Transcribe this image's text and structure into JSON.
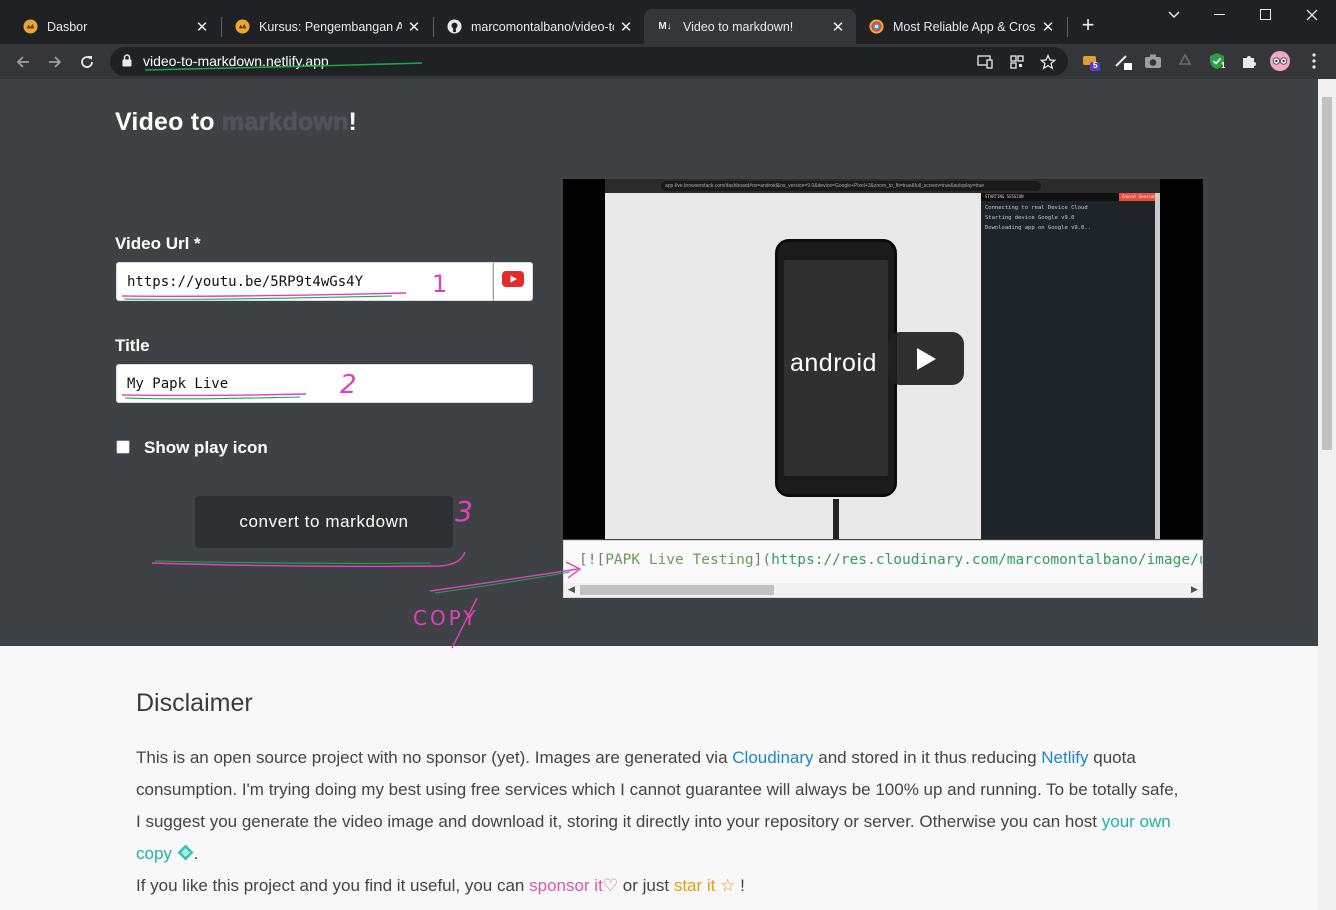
{
  "browser": {
    "tabs": [
      {
        "title": "Dasbor",
        "active": false,
        "favicon": "dicoding-icon"
      },
      {
        "title": "Kursus: Pengembangan Apl",
        "active": false,
        "favicon": "dicoding-icon"
      },
      {
        "title": "marcomontalbano/video-to",
        "active": false,
        "favicon": "github-icon"
      },
      {
        "title": "Video to markdown!",
        "active": true,
        "favicon": "markdown-icon",
        "favicon_text": "M↓"
      },
      {
        "title": "Most Reliable App & Cross",
        "active": false,
        "favicon": "browserstack-icon"
      }
    ],
    "url": "video-to-markdown.netlify.app",
    "extension_badges": {
      "ext1": "5",
      "ext2": "1"
    }
  },
  "app": {
    "title_prefix": "Video to",
    "title_dim": "markdown",
    "title_suffix": "!",
    "video_url_label": "Video Url *",
    "video_url_value": "https://youtu.be/5RP9t4wGs4Y",
    "title_label": "Title",
    "title_value": "My Papk Live",
    "show_play_label": "Show play icon",
    "show_play_checked": false,
    "convert_label": "convert to markdown",
    "markdown": {
      "open": "[![",
      "alt": "PAPK Live Testing",
      "mid": "](",
      "url": "https://res.cloudinary.com/marcomontalbano/image/upload/"
    },
    "preview": {
      "brand_text": "android",
      "console_lines": [
        "Connecting to real Device Cloud",
        "Starting device Google v9.0",
        "Downloading app on Google v9.0.."
      ],
      "screen_url": "app-live.browserstack.com/dashboard#os=android&os_version=9.0&device=Google+Pixel+3&zoom_to_fit=true&full_screen=true&autoplay=true",
      "console_header": "STARTING SESSION",
      "stop_label": "Cancel Session"
    }
  },
  "disclaimer": {
    "heading": "Disclaimer",
    "p1_a": "This is an open source project with no sponsor (yet). Images are generated via ",
    "cloudinary": "Cloudinary",
    "p1_b": " and stored in it thus reducing ",
    "netlify": "Netlify",
    "p1_c": " quota consumption. I'm trying doing my best using free services which I cannot guarantee will always be 100% up and running. To be totally safe, I suggest you generate the video image and download it, storing it directly into your repository or server. Otherwise you can host ",
    "own_copy": "your own copy",
    "p1_d": ".",
    "p2_a": "If you like this project and you find it useful, you can ",
    "sponsor": "sponsor it",
    "p2_b": " or just ",
    "star": "star it",
    "p2_c": " !"
  },
  "annotations": {
    "n1": "1",
    "n2": "2",
    "n3": "3",
    "copy": "COPY"
  },
  "colors": {
    "hero_bg": "#3f4245",
    "link_blue": "#1d87c4",
    "sponsor_pink": "#de5b9f",
    "star_gold": "#e2a016",
    "annotation_pink": "#e040c0",
    "annotation_green": "#1aa84a"
  }
}
